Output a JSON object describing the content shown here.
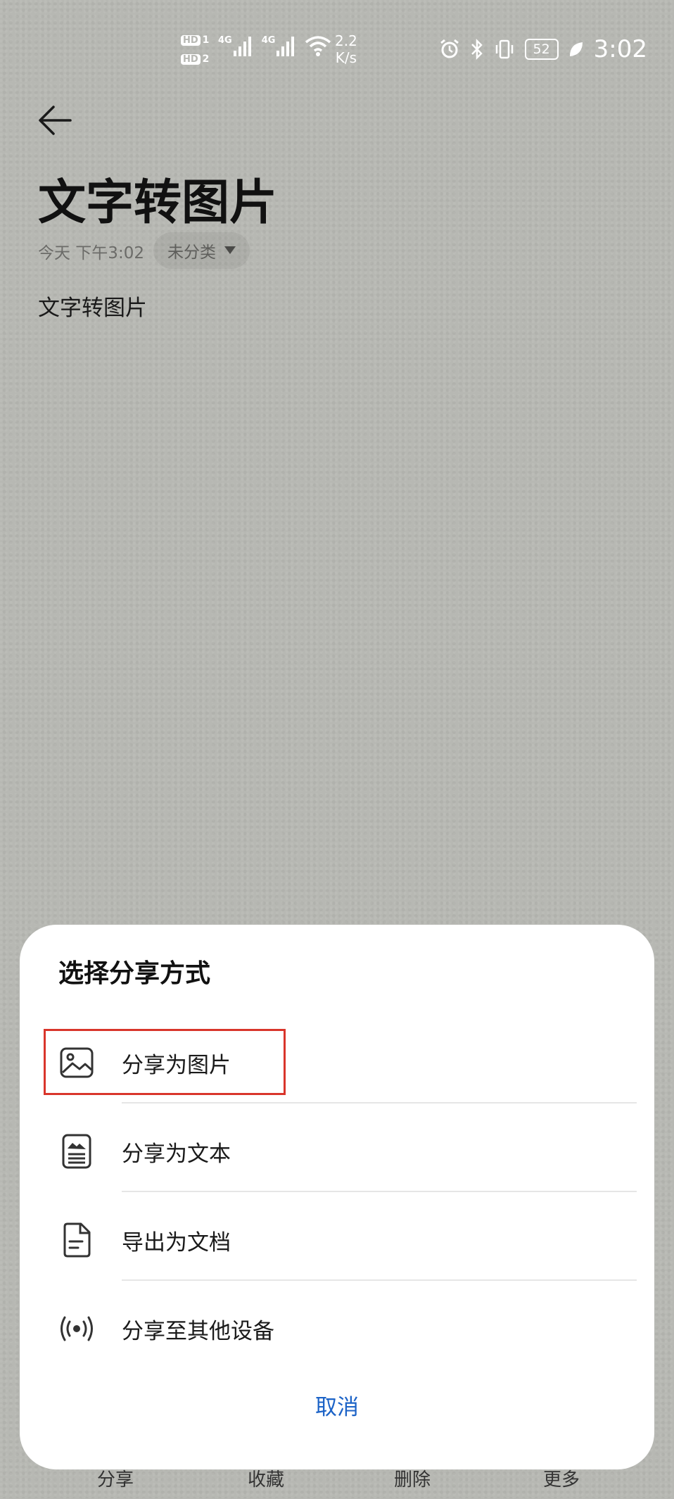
{
  "status_bar": {
    "sim1": "1",
    "sim2": "2",
    "hd": "HD",
    "net1": "4G",
    "net2": "4G",
    "speed_value": "2.2",
    "speed_unit": "K/s",
    "battery": "52",
    "time": "3:02"
  },
  "note": {
    "title": "文字转图片",
    "date": "今天 下午3:02",
    "category": "未分类",
    "body": "文字转图片"
  },
  "toolbar": {
    "share": "分享",
    "favorite": "收藏",
    "delete": "删除",
    "more": "更多"
  },
  "share_sheet": {
    "title": "选择分享方式",
    "options": [
      {
        "label": "分享为图片",
        "icon": "image-icon"
      },
      {
        "label": "分享为文本",
        "icon": "text-doc-icon"
      },
      {
        "label": "导出为文档",
        "icon": "document-icon"
      },
      {
        "label": "分享至其他设备",
        "icon": "broadcast-icon"
      }
    ],
    "cancel": "取消"
  },
  "colors": {
    "background": "#b7b8b3",
    "accent": "#1c63c7",
    "highlight": "#d9352b"
  }
}
